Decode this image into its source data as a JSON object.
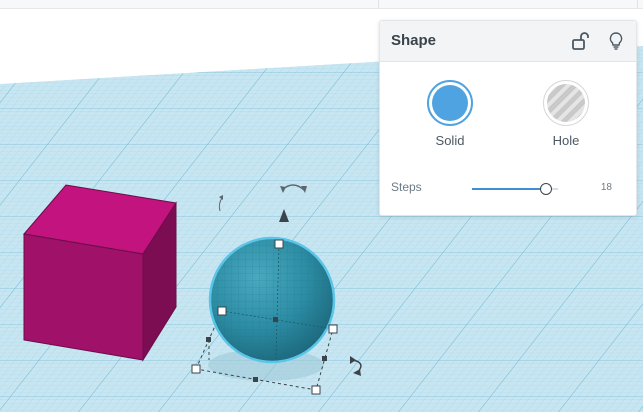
{
  "panel": {
    "title": "Shape",
    "lock_icon": "unlock-icon",
    "help_icon": "lightbulb-icon",
    "type_options": [
      {
        "label": "Solid",
        "selected": true,
        "color": "#4fa3e0"
      },
      {
        "label": "Hole",
        "selected": false,
        "color": "#c9c9c9"
      }
    ],
    "steps": {
      "label": "Steps",
      "value": "18",
      "fraction": 0.86
    }
  },
  "scene": {
    "workplane_color": "#c7e6f2",
    "cube_color": "#c0137e",
    "sphere_color": "#2b8ca3",
    "selection_color": "#5bc5e8"
  }
}
